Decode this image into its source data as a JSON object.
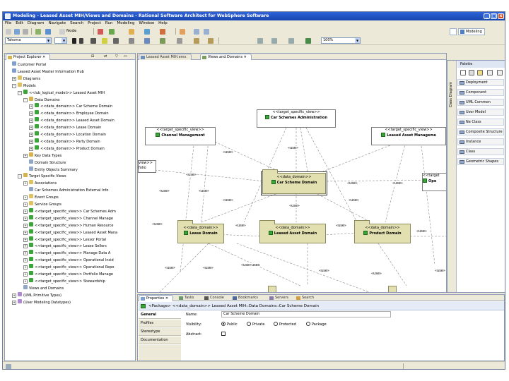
{
  "window": {
    "title": "Modeling - Leased Asset MIH/Views and Domains - Rational Software Architect for WebSphere Software",
    "controls": [
      "_",
      "□",
      "x"
    ]
  },
  "menu": [
    "File",
    "Edit",
    "Diagram",
    "Navigate",
    "Search",
    "Project",
    "Run",
    "Modeling",
    "Window",
    "Help"
  ],
  "toolbar": {
    "node_label": "Node",
    "font_combo": "Tahoma",
    "zoom_combo": "100%",
    "perspective": "Modeling"
  },
  "project_explorer": {
    "tab_label": "Project Explorer",
    "tree": [
      {
        "label": "Customer Portal",
        "indent": 0,
        "toggle": "",
        "icon": "project-icon"
      },
      {
        "label": "Leased Asset Master Information Hub",
        "indent": 0,
        "toggle": "",
        "icon": "project-icon"
      },
      {
        "label": "Diagrams",
        "indent": 1,
        "toggle": "+",
        "icon": "folder-icon"
      },
      {
        "label": "Models",
        "indent": 1,
        "toggle": "-",
        "icon": "folder-icon"
      },
      {
        "label": "<<lub_logical_model>> Leased Asset MIH",
        "indent": 2,
        "toggle": "-",
        "icon": "model-icon"
      },
      {
        "label": "Data Domains",
        "indent": 3,
        "toggle": "-",
        "icon": "package-icon"
      },
      {
        "label": "<<data_domain>> Car Scheme Domain",
        "indent": 4,
        "toggle": "+",
        "icon": "domain-icon"
      },
      {
        "label": "<<data_domain>> Employee Domain",
        "indent": 4,
        "toggle": "+",
        "icon": "domain-icon"
      },
      {
        "label": "<<data_domain>> Leased Asset Domain",
        "indent": 4,
        "toggle": "+",
        "icon": "domain-icon"
      },
      {
        "label": "<<data_domain>> Lease Domain",
        "indent": 4,
        "toggle": "+",
        "icon": "domain-icon"
      },
      {
        "label": "<<data_domain>> Location Domain",
        "indent": 4,
        "toggle": "+",
        "icon": "domain-icon"
      },
      {
        "label": "<<data_domain>> Party Domain",
        "indent": 4,
        "toggle": "+",
        "icon": "domain-icon"
      },
      {
        "label": "<<data_domain>> Product Domain",
        "indent": 4,
        "toggle": "+",
        "icon": "domain-icon"
      },
      {
        "label": "Key Data Types",
        "indent": 3,
        "toggle": "+",
        "icon": "package-icon"
      },
      {
        "label": "Domain Structure",
        "indent": 3,
        "toggle": "",
        "icon": "diagram-icon"
      },
      {
        "label": "Entity Objects Summary",
        "indent": 3,
        "toggle": "",
        "icon": "diagram-icon"
      },
      {
        "label": "Target Specific Views",
        "indent": 2,
        "toggle": "-",
        "icon": "package-icon"
      },
      {
        "label": "Associations",
        "indent": 3,
        "toggle": "+",
        "icon": "folder-icon"
      },
      {
        "label": "Car Schemes Administration External Info",
        "indent": 3,
        "toggle": "",
        "icon": "diagram-icon"
      },
      {
        "label": "Event Groups",
        "indent": 3,
        "toggle": "+",
        "icon": "folder-icon"
      },
      {
        "label": "Service Groups",
        "indent": 3,
        "toggle": "+",
        "icon": "folder-icon"
      },
      {
        "label": "<<target_specific_view>> Car Schemes Adm",
        "indent": 3,
        "toggle": "+",
        "icon": "view-icon"
      },
      {
        "label": "<<target_specific_view>> Channel Manage",
        "indent": 3,
        "toggle": "+",
        "icon": "view-icon"
      },
      {
        "label": "<<target_specific_view>> Human Resource",
        "indent": 3,
        "toggle": "+",
        "icon": "view-icon"
      },
      {
        "label": "<<target_specific_view>> Leased Asset Mana",
        "indent": 3,
        "toggle": "+",
        "icon": "view-icon"
      },
      {
        "label": "<<target_specific_view>> Lessor Portal",
        "indent": 3,
        "toggle": "+",
        "icon": "view-icon"
      },
      {
        "label": "<<target_specific_view>> Lease Sellers",
        "indent": 3,
        "toggle": "+",
        "icon": "view-icon"
      },
      {
        "label": "<<target_specific_view>> Manage Data A",
        "indent": 3,
        "toggle": "+",
        "icon": "view-icon"
      },
      {
        "label": "<<target_specific_view>> Operational Insid",
        "indent": 3,
        "toggle": "+",
        "icon": "view-icon"
      },
      {
        "label": "<<target_specific_view>> Operational Repo",
        "indent": 3,
        "toggle": "+",
        "icon": "view-icon"
      },
      {
        "label": "<<target_specific_view>> Portfolio Manage",
        "indent": 3,
        "toggle": "+",
        "icon": "view-icon"
      },
      {
        "label": "<<target_specific_view>> Stewardship",
        "indent": 3,
        "toggle": "+",
        "icon": "view-icon"
      },
      {
        "label": "Views and Domains",
        "indent": 2,
        "toggle": "",
        "icon": "diagram-icon"
      },
      {
        "label": "(UML Primitive Types)",
        "indent": 1,
        "toggle": "+",
        "icon": "library-icon"
      },
      {
        "label": "(User Modeling Datatypes)",
        "indent": 1,
        "toggle": "+",
        "icon": "library-icon"
      }
    ]
  },
  "editor": {
    "tabs": [
      "Leased Asset MIH.emx",
      "Views and Domains"
    ],
    "diagram": {
      "views": [
        {
          "id": "car",
          "stereotype": "<<target_specific_view>>",
          "name": "Car Schemes Administration"
        },
        {
          "id": "chan",
          "stereotype": "<<target_specific_view>>",
          "name": "Channel Management"
        },
        {
          "id": "lam",
          "stereotype": "<<target_specific_view>>",
          "name": "Leased Asset Manageme"
        },
        {
          "id": "left",
          "stereotype": "view>>",
          "name": "folio"
        },
        {
          "id": "right",
          "stereotype": "<<target",
          "name": "Ope"
        }
      ],
      "domains": [
        {
          "id": "carsd",
          "stereotype": "<<data_domain>>",
          "name": "Car Scheme Domain"
        },
        {
          "id": "lease",
          "stereotype": "<<data_domain>>",
          "name": "Lease Domain"
        },
        {
          "id": "lad",
          "stereotype": "<<data_domain>>",
          "name": "Leased Asset Domain"
        },
        {
          "id": "prod",
          "stereotype": "<<data_domain>>",
          "name": "Product Domain"
        }
      ],
      "use_label": "«use»",
      "uses_label": "«use»uses"
    }
  },
  "palette": {
    "title": "Palette",
    "side_tab": "Class Diagram",
    "items": [
      "Deployment",
      "Component",
      "UML Common",
      "User Model",
      "Ne Class",
      "Composite Structure",
      "Instance",
      "Class",
      "Geometric Shapes"
    ]
  },
  "properties": {
    "tabs": [
      "Properties",
      "Tasks",
      "Console",
      "Bookmarks",
      "Servers",
      "Search"
    ],
    "header": "<Package> <<data_domain>> Leased Asset MIH::Data Domains::Car Scheme Domain",
    "sections": [
      "General",
      "Profiles",
      "Stereotype",
      "Documentation"
    ],
    "name_label": "Name:",
    "name_value": "Car Scheme Domain",
    "visibility_label": "Visibility:",
    "visibility_options": [
      "Public",
      "Private",
      "Protected",
      "Package"
    ],
    "visibility_selected": "Public",
    "abstract_label": "Abstract:"
  }
}
